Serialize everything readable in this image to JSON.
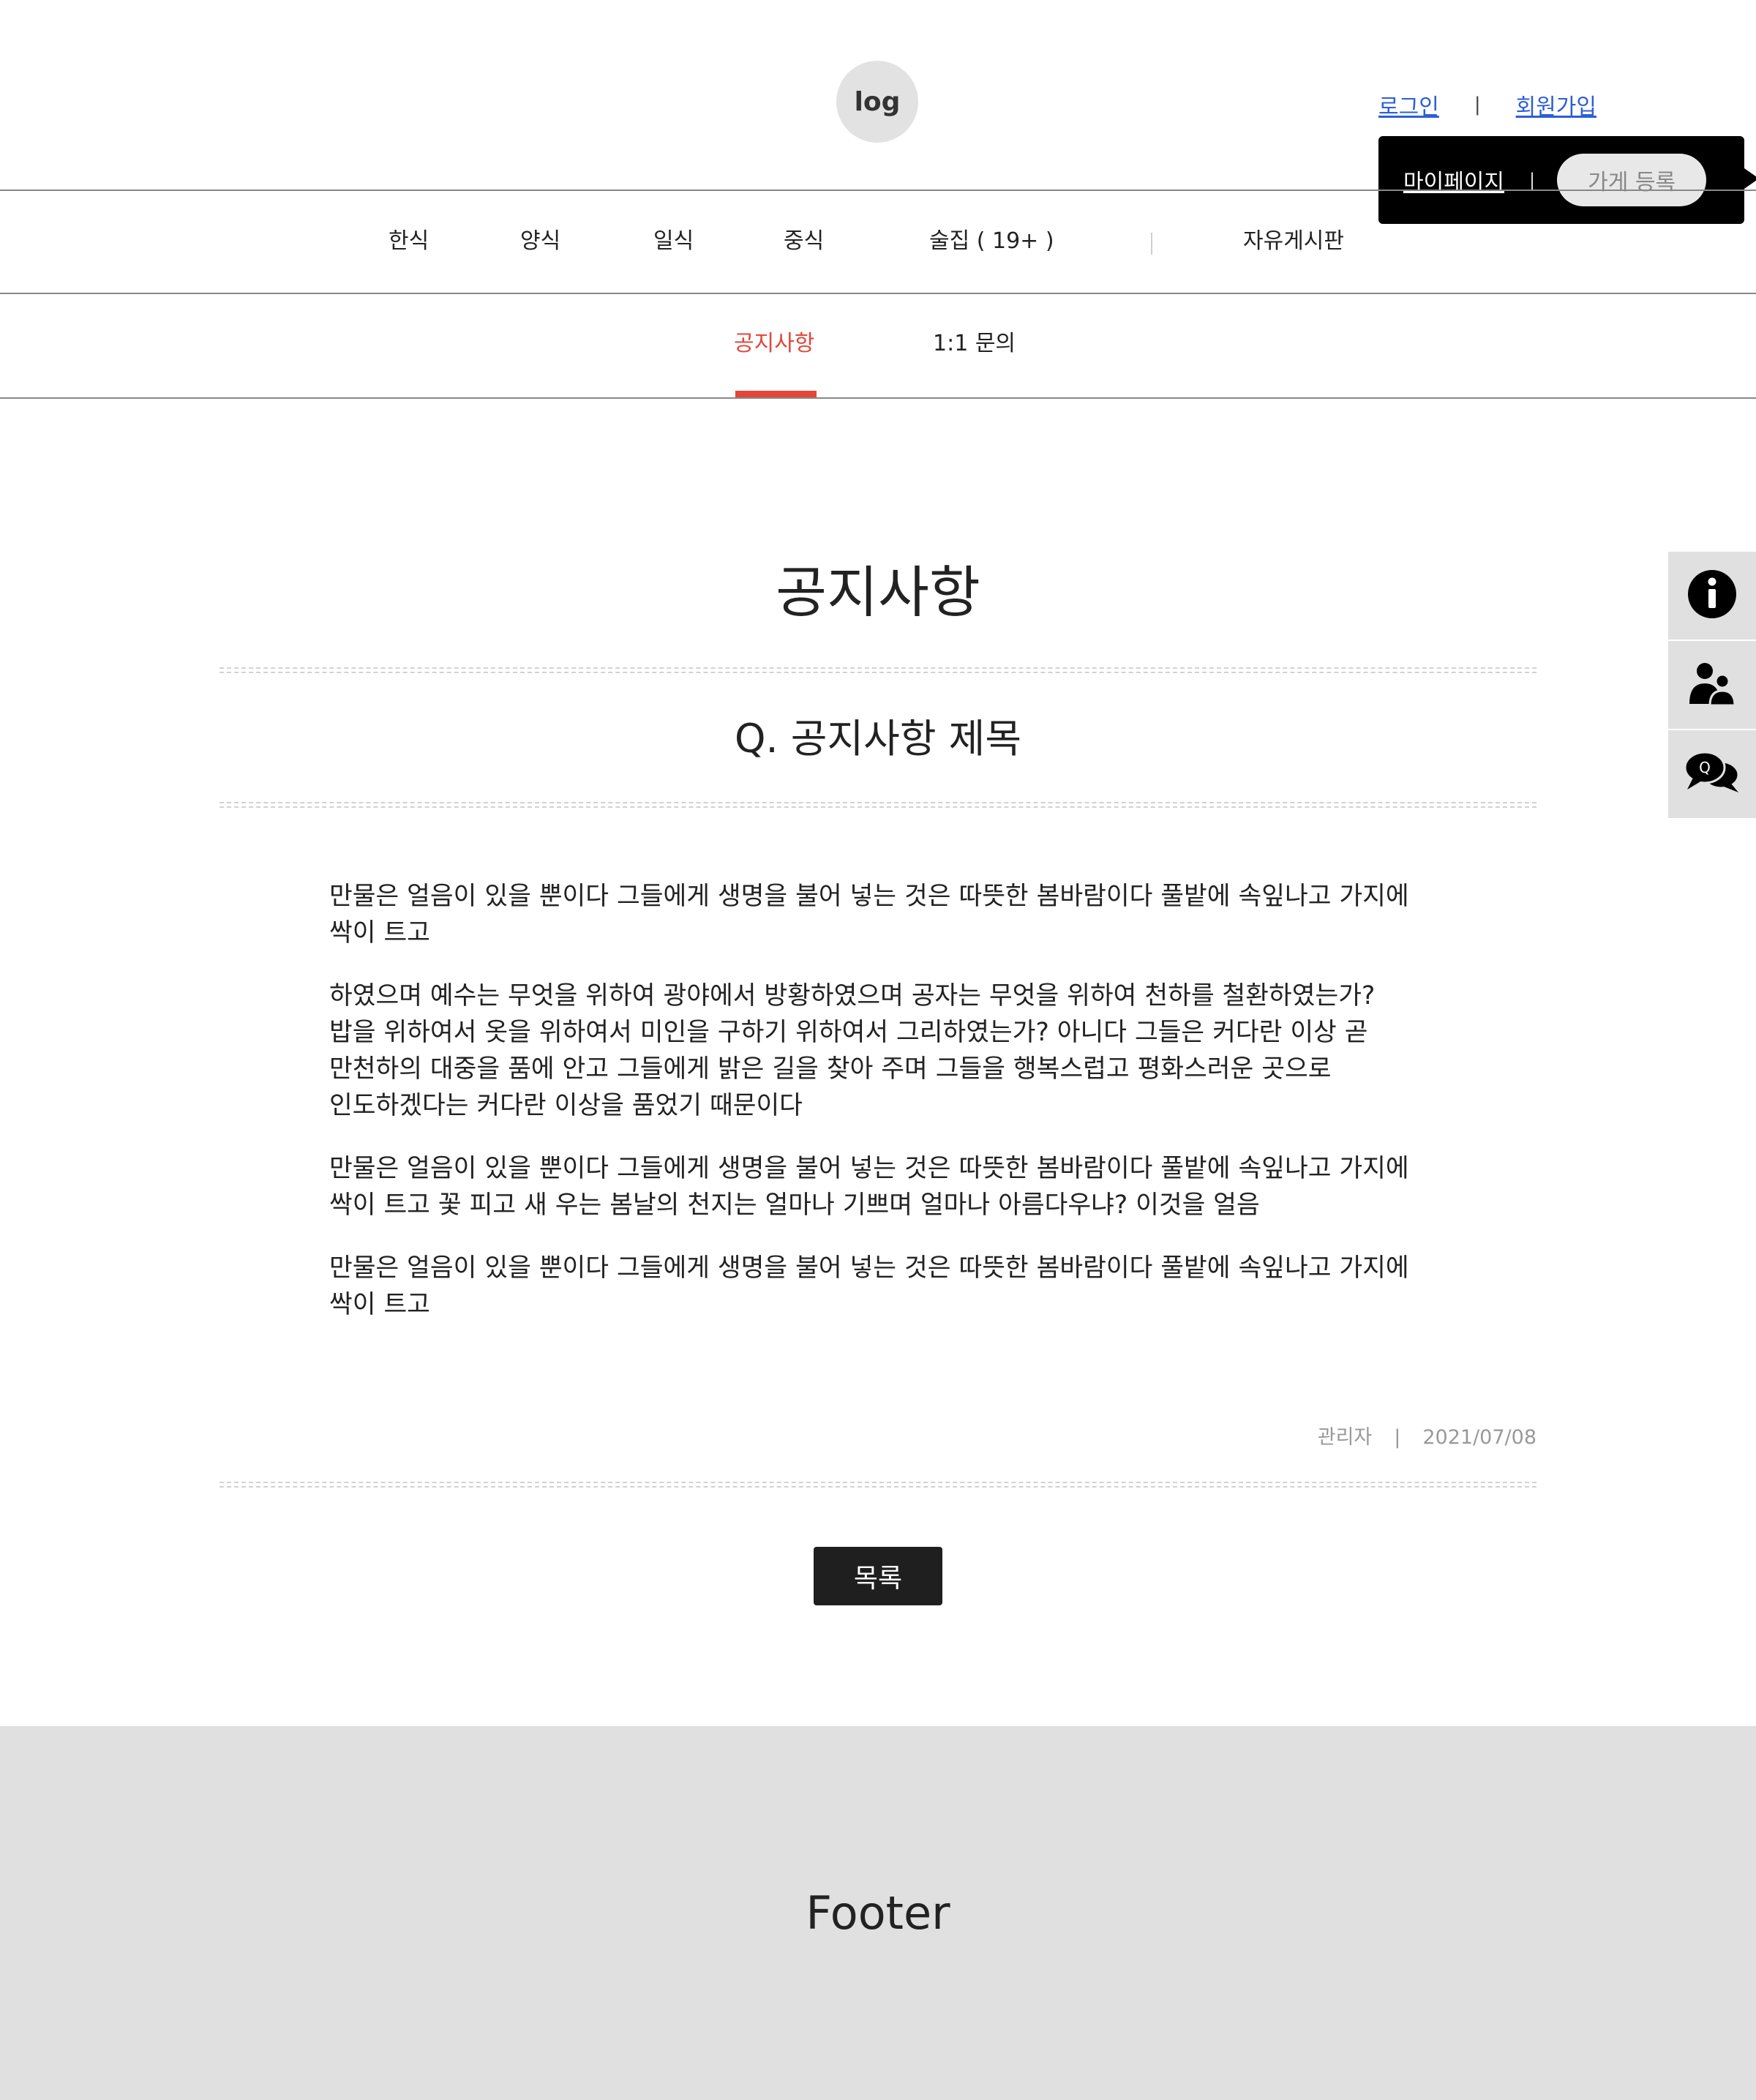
{
  "header": {
    "logo_text": "log",
    "login_label": "로그인",
    "auth_separator": "|",
    "signup_label": "회원가입"
  },
  "user_popup": {
    "mypage_label": "마이페이지",
    "separator": "|",
    "store_register_label": "가게 등록"
  },
  "nav": {
    "items": [
      {
        "label": "한식"
      },
      {
        "label": "양식"
      },
      {
        "label": "일식"
      },
      {
        "label": "중식"
      },
      {
        "label": "술집 ( 19+ )"
      },
      {
        "label": "자유게시판"
      }
    ]
  },
  "subnav": {
    "tabs": [
      {
        "label": "공지사항",
        "active": true
      },
      {
        "label": "1:1 문의",
        "active": false
      }
    ]
  },
  "side_menu": {
    "items": [
      {
        "icon": "info-icon"
      },
      {
        "icon": "users-icon"
      },
      {
        "icon": "qna-chat-icon",
        "glyph": "Q"
      }
    ]
  },
  "page": {
    "title": "공지사항"
  },
  "post": {
    "title": "Q. 공지사항 제목",
    "paragraphs": [
      "만물은 얼음이 있을 뿐이다 그들에게 생명을 불어 넣는 것은 따뜻한 봄바람이다 풀밭에 속잎나고 가지에 싹이 트고",
      "하였으며 예수는 무엇을 위하여 광야에서 방황하였으며 공자는 무엇을 위하여 천하를 철환하였는가? 밥을 위하여서 옷을 위하여서 미인을 구하기 위하여서 그리하였는가? 아니다 그들은 커다란 이상 곧 만천하의 대중을 품에 안고 그들에게 밝은 길을 찾아 주며 그들을 행복스럽고 평화스러운 곳으로 인도하겠다는 커다란 이상을 품었기 때문이다",
      "만물은 얼음이 있을 뿐이다 그들에게 생명을 불어 넣는 것은 따뜻한 봄바람이다 풀밭에 속잎나고 가지에 싹이 트고 꽃 피고 새 우는 봄날의 천지는 얼마나 기쁘며 얼마나 아름다우냐? 이것을 얼음",
      "만물은 얼음이 있을 뿐이다 그들에게 생명을 불어 넣는 것은 따뜻한 봄바람이다 풀밭에 속잎나고 가지에 싹이 트고"
    ],
    "author": "관리자",
    "meta_separator": "|",
    "date": "2021/07/08",
    "list_button_label": "목록"
  },
  "footer": {
    "text": "Footer"
  },
  "colors": {
    "accent": "#e2473a",
    "link": "#2c5fd6",
    "footer_bg": "#e0e0e0",
    "button_bg": "#1f1f1f"
  }
}
